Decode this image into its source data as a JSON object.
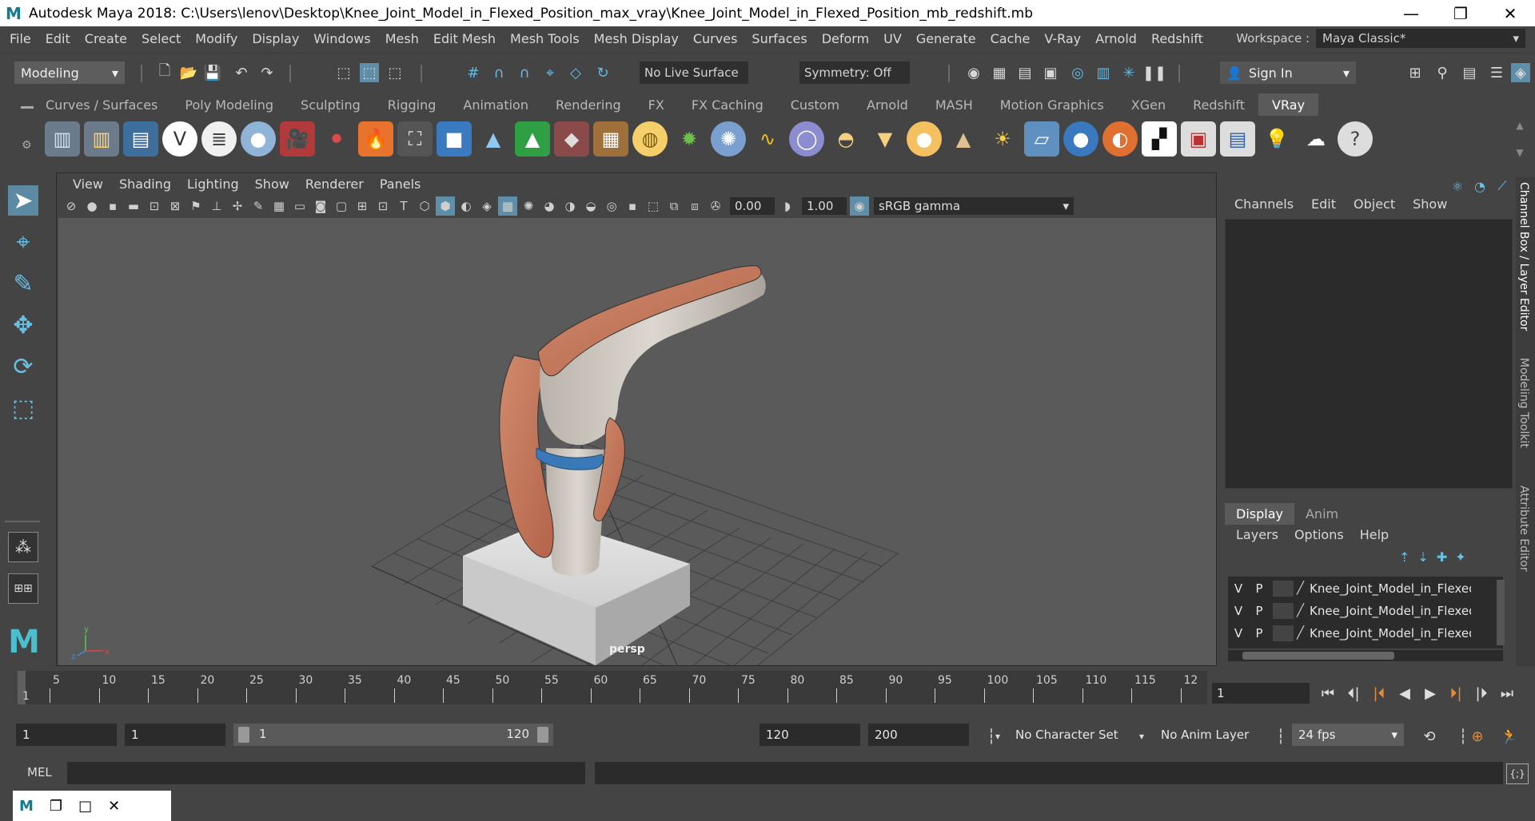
{
  "titlebar": {
    "app_logo": "M",
    "title": "Autodesk Maya 2018: C:\\Users\\lenov\\Desktop\\Knee_Joint_Model_in_Flexed_Position_max_vray\\Knee_Joint_Model_in_Flexed_Position_mb_redshift.mb",
    "minimize": "—",
    "maximize": "❐",
    "close": "✕"
  },
  "menubar": {
    "items": [
      "File",
      "Edit",
      "Create",
      "Select",
      "Modify",
      "Display",
      "Windows",
      "Mesh",
      "Edit Mesh",
      "Mesh Tools",
      "Mesh Display",
      "Curves",
      "Surfaces",
      "Deform",
      "UV",
      "Generate",
      "Cache",
      "V-Ray",
      "Arnold",
      "Redshift"
    ],
    "workspace_label": "Workspace :",
    "workspace_value": "Maya Classic*"
  },
  "statusline": {
    "mode": "Modeling",
    "live_surface": "No Live Surface",
    "symmetry": "Symmetry: Off",
    "sign_in": "Sign In"
  },
  "shelf": {
    "tabs": [
      "Curves / Surfaces",
      "Poly Modeling",
      "Sculpting",
      "Rigging",
      "Animation",
      "Rendering",
      "FX",
      "FX Caching",
      "Custom",
      "Arnold",
      "MASH",
      "Motion Graphics",
      "XGen",
      "Redshift",
      "VRay"
    ],
    "active_tab": "VRay",
    "icons": [
      "vray-materials-icon",
      "vray-lights-icon",
      "vray-framebuffer-icon",
      "vray-logo-icon",
      "vray-script-icon",
      "vray-sphere-icon",
      "vray-camera-icon",
      "vray-molecule-icon",
      "vray-fire-icon",
      "vray-plane-icon",
      "vray-box-icon",
      "vray-cone-icon",
      "vray-terrain-icon",
      "vray-proxy-icon",
      "vray-texture-icon",
      "vray-globe-icon",
      "vray-fur-icon",
      "vray-particles-icon",
      "vray-curve-icon",
      "vray-dome-icon",
      "vray-sphere-light-icon",
      "vray-spot-icon",
      "vray-sun-icon",
      "vray-ies-icon",
      "vray-sunlight-icon",
      "vray-rect-icon",
      "vray-ball-icon",
      "vray-half-sphere-icon",
      "vray-checker-icon",
      "vray-render-icon",
      "vray-settings-icon",
      "vray-bulb-icon",
      "vray-cloud-icon",
      "vray-help-icon"
    ]
  },
  "viewport": {
    "menu": [
      "View",
      "Shading",
      "Lighting",
      "Show",
      "Renderer",
      "Panels"
    ],
    "exposure": "0.00",
    "gamma": "1.00",
    "color_space": "sRGB gamma",
    "camera_label": "persp"
  },
  "channel_box": {
    "menu": [
      "Channels",
      "Edit",
      "Object",
      "Show"
    ],
    "side_tabs": [
      "Channel Box / Layer Editor",
      "Modeling Toolkit",
      "Attribute Editor"
    ]
  },
  "layer_editor": {
    "tabs": [
      "Display",
      "Anim"
    ],
    "active_tab": "Display",
    "menu": [
      "Layers",
      "Options",
      "Help"
    ],
    "layers": [
      {
        "v": "V",
        "p": "P",
        "name": "Knee_Joint_Model_in_Flexed"
      },
      {
        "v": "V",
        "p": "P",
        "name": "Knee_Joint_Model_in_Flexed"
      },
      {
        "v": "V",
        "p": "P",
        "name": "Knee_Joint_Model_in_Flexed"
      }
    ]
  },
  "timeslider": {
    "start_label": "1",
    "ticks": [
      "5",
      "10",
      "15",
      "20",
      "25",
      "30",
      "35",
      "40",
      "45",
      "50",
      "55",
      "60",
      "65",
      "70",
      "75",
      "80",
      "85",
      "90",
      "95",
      "100",
      "105",
      "110",
      "115",
      "12"
    ],
    "current_frame": "1"
  },
  "range": {
    "anim_start": "1",
    "playback_start": "1",
    "range_start": "1",
    "range_end": "120",
    "playback_end": "120",
    "anim_end": "200",
    "character_set": "No Character Set",
    "anim_layer": "No Anim Layer",
    "fps": "24 fps"
  },
  "command_line": {
    "label": "MEL"
  },
  "colors": {
    "accent": "#5f8ea8",
    "icon_blue": "#6ac0e4",
    "muscle": "#c87a5e",
    "bone": "#d8d2ca",
    "cartilage": "#3a78b8"
  }
}
